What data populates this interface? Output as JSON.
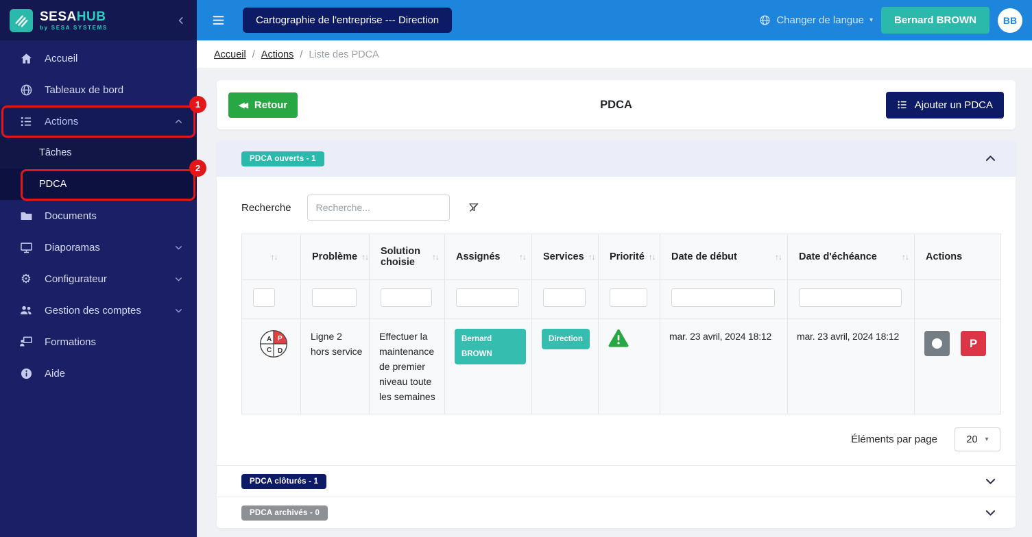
{
  "brand": {
    "primary": "SESA",
    "secondary": "HUB",
    "tagline": "by SESA SYSTEMS"
  },
  "header": {
    "context": "Cartographie de l'entreprise --- Direction",
    "language": "Changer de langue",
    "user": "Bernard BROWN",
    "initials": "BB"
  },
  "sidebar": {
    "items": [
      {
        "label": "Accueil"
      },
      {
        "label": "Tableaux de bord"
      },
      {
        "label": "Actions",
        "children": [
          {
            "label": "Tâches"
          },
          {
            "label": "PDCA"
          }
        ]
      },
      {
        "label": "Documents"
      },
      {
        "label": "Diaporamas"
      },
      {
        "label": "Configurateur"
      },
      {
        "label": "Gestion des comptes"
      },
      {
        "label": "Formations"
      },
      {
        "label": "Aide"
      }
    ]
  },
  "breadcrumb": {
    "home": "Accueil",
    "section": "Actions",
    "current": "Liste des PDCA",
    "sep": "/"
  },
  "toolbar": {
    "back": "Retour",
    "title": "PDCA",
    "add": "Ajouter un PDCA"
  },
  "sections": {
    "open": "PDCA ouverts - 1",
    "closed": "PDCA clôturés - 1",
    "archived": "PDCA archivés - 0"
  },
  "search": {
    "label": "Recherche",
    "placeholder": "Recherche..."
  },
  "table": {
    "headers": {
      "probleme": "Problème",
      "solution": "Solution choisie",
      "assignes": "Assignés",
      "services": "Services",
      "priorite": "Priorité",
      "date_debut": "Date de début",
      "date_echeance": "Date d'échéance",
      "actions": "Actions"
    },
    "row": {
      "probleme": "Ligne 2 hors service",
      "solution": "Effectuer la maintenance de premier niveau toute les semaines",
      "assigne_badge": "Bernard BROWN",
      "service_badge": "Direction",
      "priorite": "warning",
      "date_debut": "mar. 23 avril, 2024 18:12",
      "date_echeance": "mar. 23 avril, 2024 18:12",
      "action_letter": "P"
    },
    "pdca_letters": {
      "a": "A",
      "p": "P",
      "c": "C",
      "d": "D"
    }
  },
  "pagination": {
    "label": "Éléments par page",
    "per_page": "20"
  },
  "icons": {
    "sort": "↑↓",
    "caret_down": "▾",
    "back_arrows": "◀◀"
  },
  "annotations": {
    "first": "1",
    "second": "2"
  },
  "colors": {
    "sidebar_navy": "#1b1f66",
    "header_blue": "#1e85dd",
    "teal": "#2bb9ab",
    "navy_button": "#0d1a66",
    "green": "#28a745",
    "annotation_red": "#e31717"
  }
}
